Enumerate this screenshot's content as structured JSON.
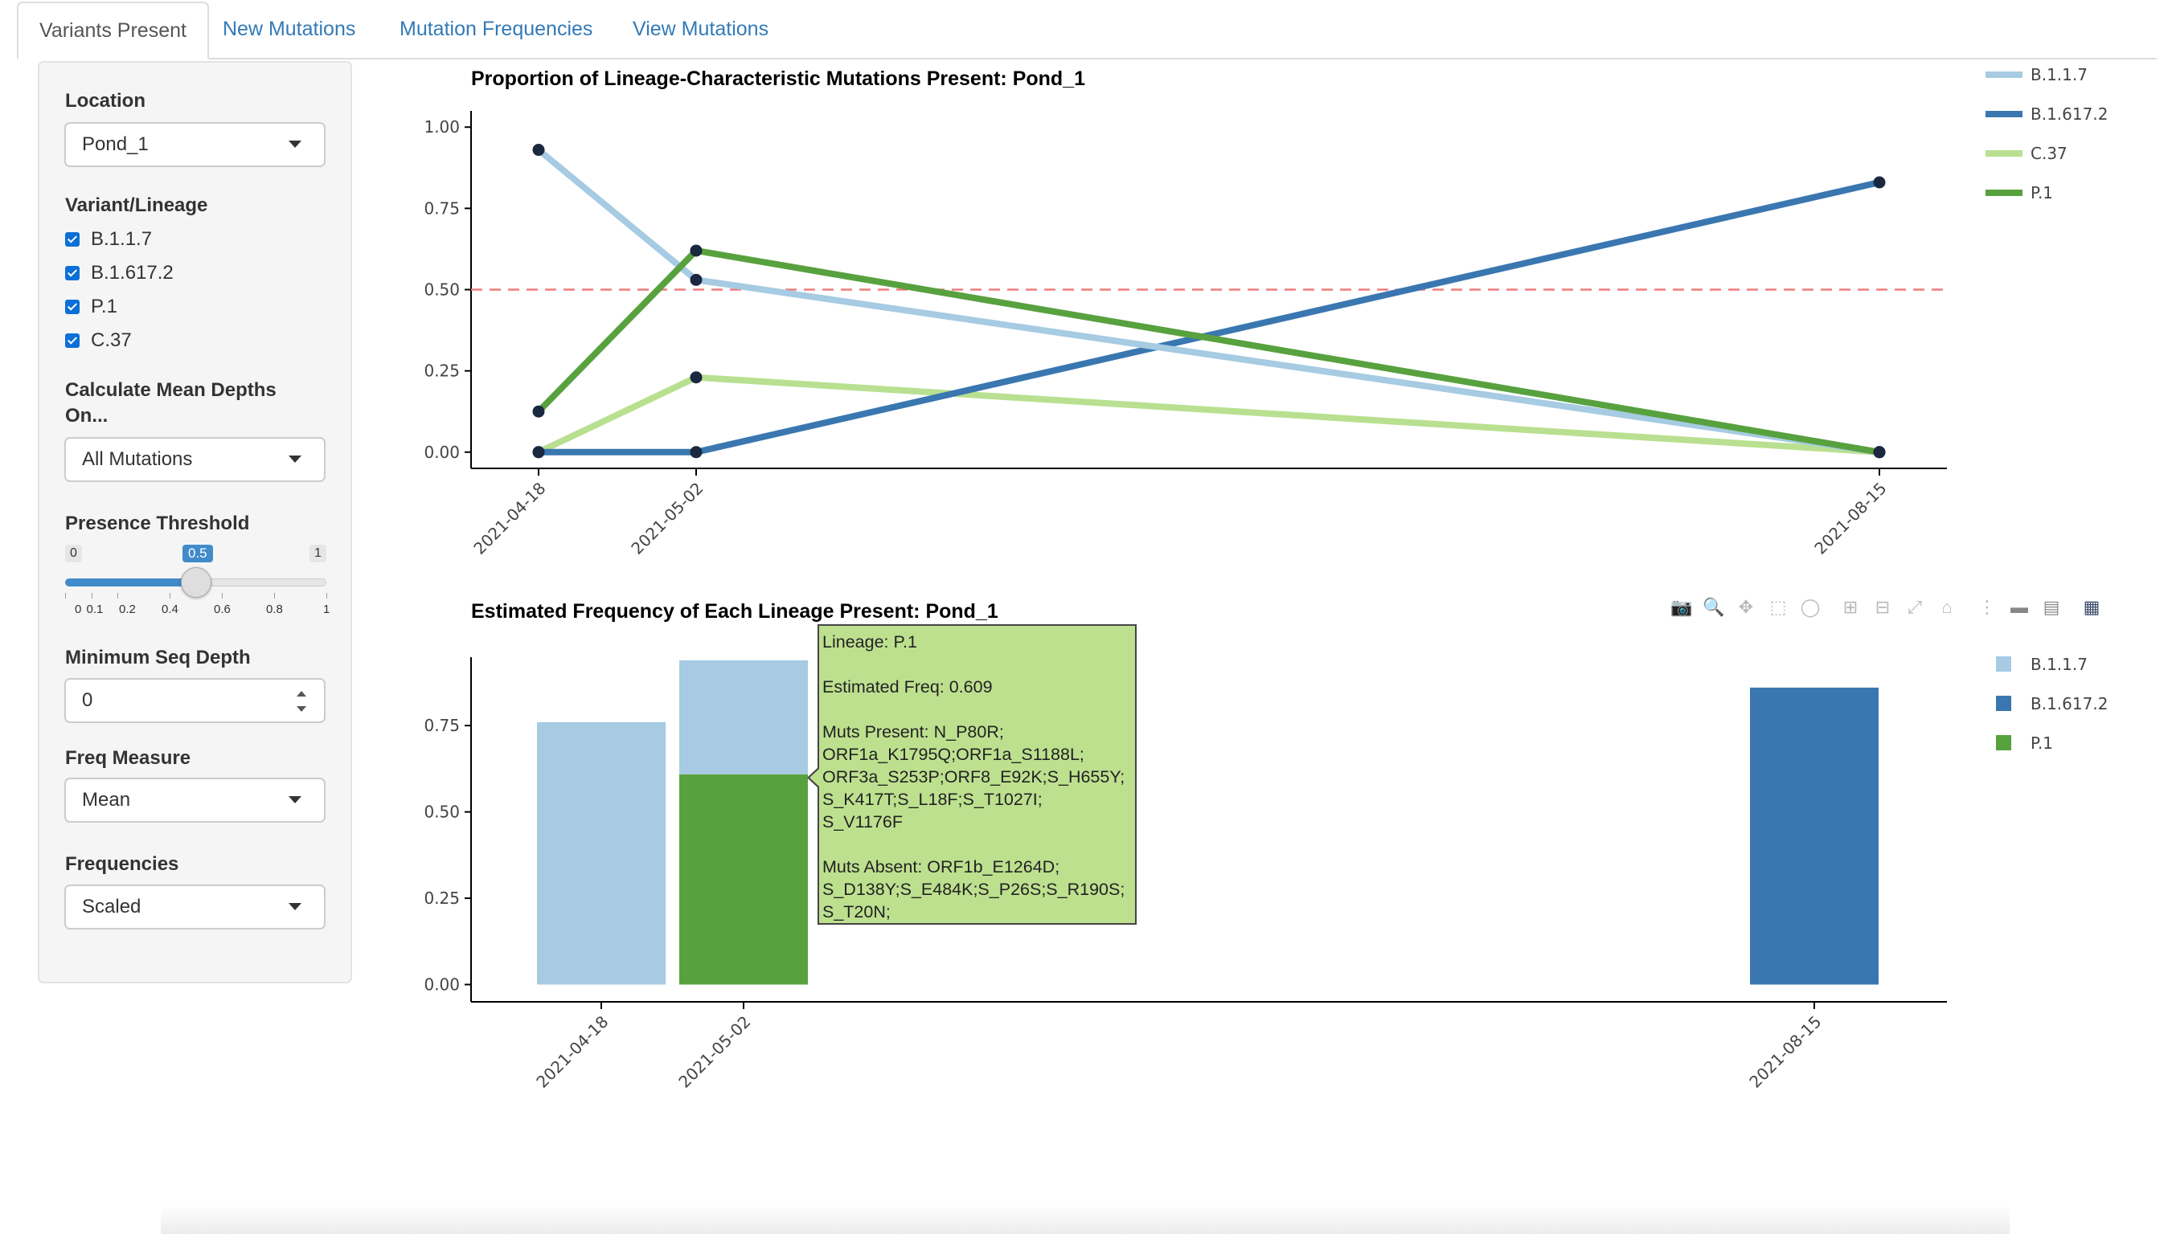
{
  "tabs": [
    {
      "label": "Variants Present",
      "active": true
    },
    {
      "label": "New Mutations",
      "active": false
    },
    {
      "label": "Mutation Frequencies",
      "active": false
    },
    {
      "label": "View Mutations",
      "active": false
    }
  ],
  "sidebar": {
    "location": {
      "label": "Location",
      "value": "Pond_1"
    },
    "variants": {
      "label": "Variant/Lineage",
      "items": [
        {
          "label": "B.1.1.7",
          "checked": true
        },
        {
          "label": "B.1.617.2",
          "checked": true
        },
        {
          "label": "P.1",
          "checked": true
        },
        {
          "label": "C.37",
          "checked": true
        }
      ]
    },
    "mean_depths": {
      "label_line1": "Calculate Mean Depths",
      "label_line2": "On...",
      "value": "All Mutations"
    },
    "threshold": {
      "label": "Presence Threshold",
      "min": "0",
      "max": "1",
      "value": "0.5",
      "value_fraction": 0.5,
      "ticks": [
        "0",
        "0.1",
        "0.2",
        "0.4",
        "0.6",
        "0.8",
        "1"
      ]
    },
    "min_seq_depth": {
      "label": "Minimum Seq Depth",
      "value": "0"
    },
    "freq_measure": {
      "label": "Freq Measure",
      "value": "Mean"
    },
    "frequencies": {
      "label": "Frequencies",
      "value": "Scaled"
    }
  },
  "colors": {
    "B.1.1.7": "#a6cbe2",
    "B.1.617.2": "#3a77b0",
    "C.37": "#b8e090",
    "P.1": "#58a13f",
    "threshold_line": "#ef7d7d",
    "marker": "#1a2840"
  },
  "modebar_icons": [
    "camera-icon",
    "zoom-icon",
    "pan-icon",
    "box-select-icon",
    "lasso-icon",
    "zoom-in-icon",
    "zoom-out-icon",
    "autoscale-icon",
    "reset-axes-icon",
    "spike-lines-icon",
    "hover-closest-icon",
    "hover-compare-icon",
    "plotly-logo-icon"
  ],
  "chart_data": [
    {
      "type": "line",
      "title": "Proportion of Lineage-Characteristic Mutations Present: Pond_1",
      "x": [
        "2021-04-18",
        "2021-05-02",
        "2021-08-15"
      ],
      "y_ticks": [
        "0.00",
        "0.25",
        "0.50",
        "0.75",
        "1.00"
      ],
      "ylim": [
        -0.05,
        1.05
      ],
      "threshold": 0.5,
      "legend_position": "right",
      "legend": [
        "B.1.1.7",
        "B.1.617.2",
        "C.37",
        "P.1"
      ],
      "series": [
        {
          "name": "B.1.1.7",
          "values": [
            0.93,
            0.53,
            0.0
          ]
        },
        {
          "name": "B.1.617.2",
          "values": [
            0.0,
            0.0,
            0.83
          ]
        },
        {
          "name": "C.37",
          "values": [
            0.0,
            0.23,
            0.0
          ]
        },
        {
          "name": "P.1",
          "values": [
            0.125,
            0.62,
            0.0
          ]
        }
      ]
    },
    {
      "type": "bar",
      "stacked": true,
      "title": "Estimated Frequency of Each Lineage Present: Pond_1",
      "x": [
        "2021-04-18",
        "2021-05-02",
        "2021-08-15"
      ],
      "y_ticks": [
        "0.00",
        "0.25",
        "0.50",
        "0.75"
      ],
      "ylim": [
        -0.05,
        0.99
      ],
      "legend_position": "right",
      "legend": [
        "B.1.1.7",
        "B.1.617.2",
        "P.1"
      ],
      "series": [
        {
          "name": "P.1",
          "values": [
            0,
            0.609,
            0
          ]
        },
        {
          "name": "B.1.1.7",
          "values": [
            0.76,
            0.33,
            0
          ]
        },
        {
          "name": "B.1.617.2",
          "values": [
            0,
            0,
            0.86
          ]
        }
      ],
      "tooltip": {
        "lineage": "Lineage: P.1",
        "freq": "Estimated Freq: 0.609",
        "present": "Muts Present: N_P80R;\nORF1a_K1795Q;ORF1a_S1188L;\nORF3a_S253P;ORF8_E92K;S_H655Y;\nS_K417T;S_L18F;S_T1027I;\nS_V1176F",
        "absent": "Muts Absent: ORF1b_E1264D;\nS_D138Y;S_E484K;S_P26S;S_R190S;\nS_T20N;"
      }
    }
  ]
}
